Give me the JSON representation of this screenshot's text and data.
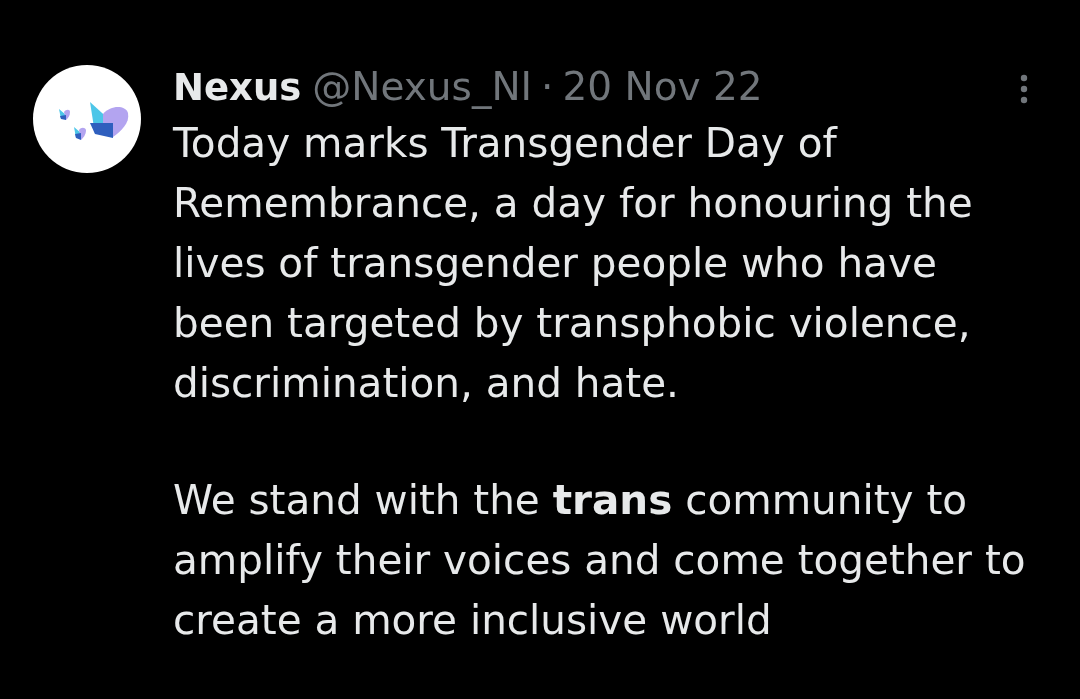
{
  "tweet": {
    "author": {
      "name": "Nexus",
      "handle": "@Nexus_NI",
      "separator": "·",
      "date": "20 Nov 22"
    },
    "paragraphs": [
      "Today marks Transgender Day of Remembrance, a day for honouring the lives of transgender people who have been targeted by transphobic violence, discrimination, and hate.",
      "We stand with the **trans** community to amplify their voices and come together to create a more inclusive world"
    ]
  }
}
